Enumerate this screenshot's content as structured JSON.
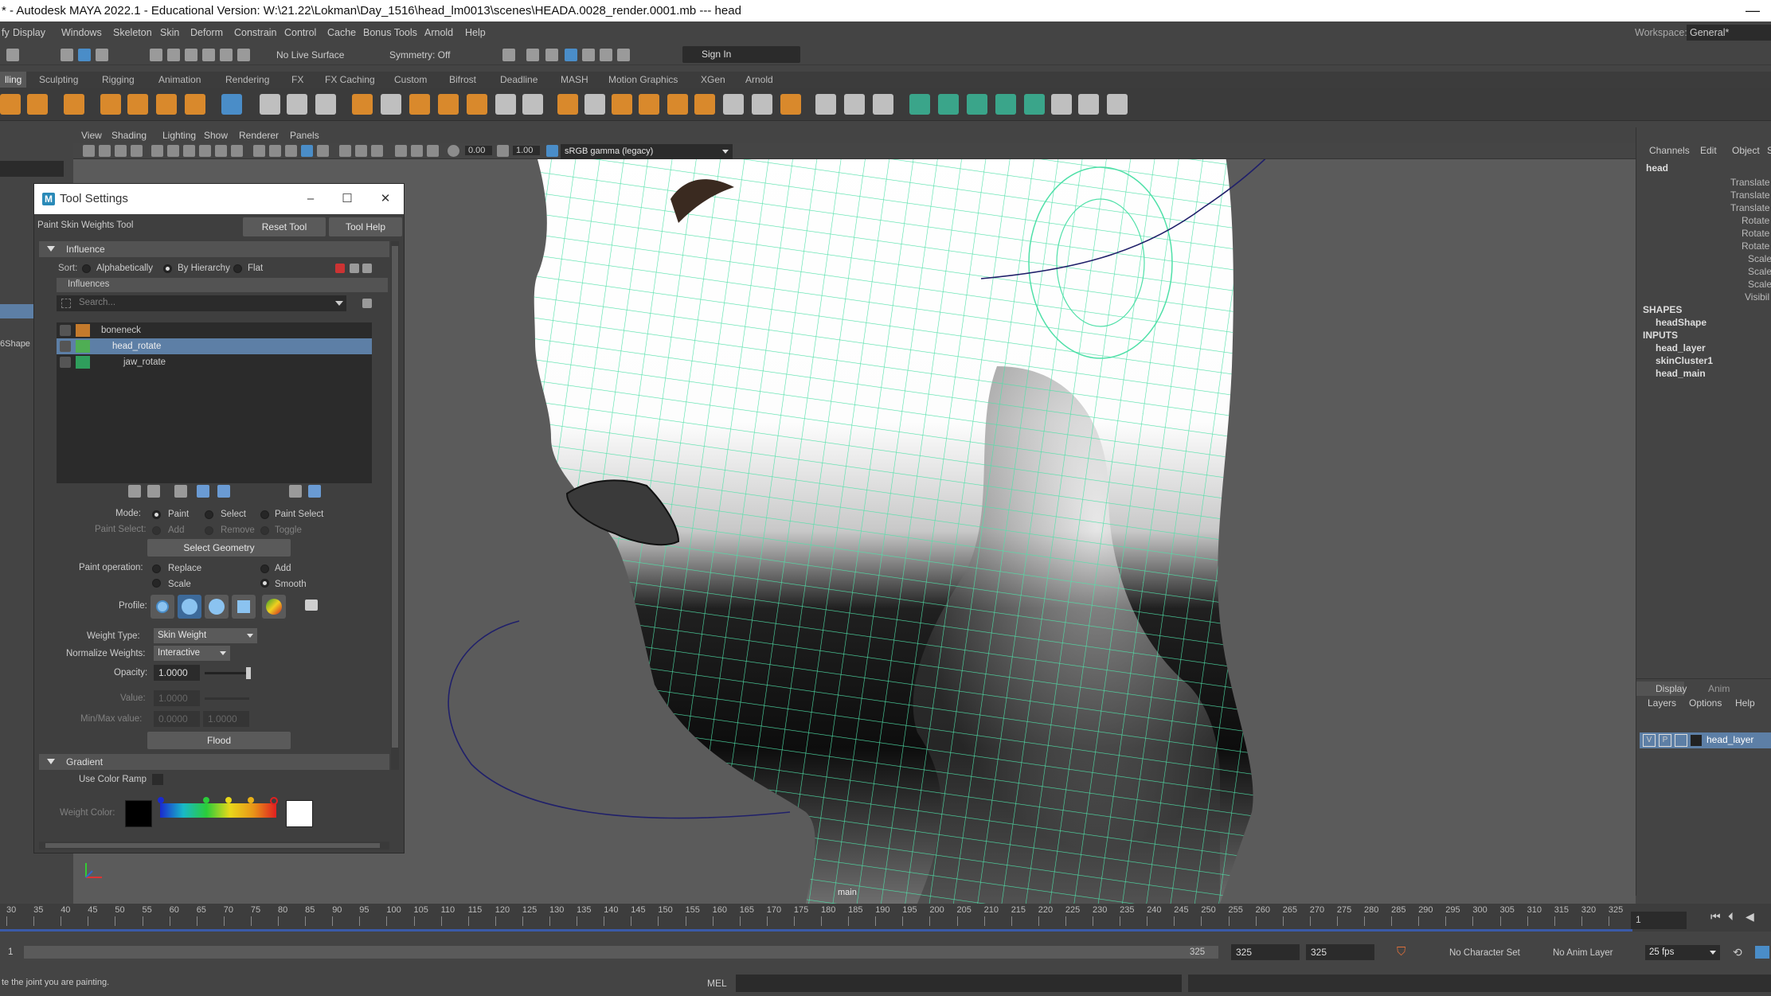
{
  "title": "* - Autodesk MAYA 2022.1 - Educational Version: W:\\21.22\\Lokman\\Day_1516\\head_lm0013\\scenes\\HEADA.0028_render.0001.mb   ---   head",
  "menu": [
    "fy",
    "Display",
    "Windows",
    "Skeleton",
    "Skin",
    "Deform",
    "Constrain",
    "Control",
    "Cache",
    "Bonus Tools",
    "Arnold",
    "Help"
  ],
  "workspace_label": "Workspace:",
  "workspace_value": "General*",
  "status": {
    "live_surface": "No Live Surface",
    "symmetry": "Symmetry: Off",
    "sign_in": "Sign In"
  },
  "shelf_tabs": [
    "lling",
    "Sculpting",
    "Rigging",
    "Animation",
    "Rendering",
    "FX",
    "FX Caching",
    "Custom",
    "Bifrost",
    "Deadline",
    "MASH",
    "Motion Graphics",
    "XGen",
    "Arnold"
  ],
  "viewport_menu": [
    "View",
    "Shading",
    "Lighting",
    "Show",
    "Renderer",
    "Panels"
  ],
  "viewport_tools": {
    "exposure": "0.00",
    "gamma": "1.00",
    "colorspace": "sRGB gamma (legacy)"
  },
  "camera_label": "main",
  "left_item": "6Shape",
  "tool": {
    "window_title": "Tool Settings",
    "tool_name": "Paint Skin Weights Tool",
    "reset": "Reset Tool",
    "help": "Tool Help",
    "influence_section": "Influence",
    "sort_label": "Sort:",
    "sort_options": [
      "Alphabetically",
      "By Hierarchy",
      "Flat"
    ],
    "influences_label": "Influences",
    "search_placeholder": "Search...",
    "influences": [
      {
        "name": "boneneck",
        "color": "#c47a2c",
        "selected": false
      },
      {
        "name": "head_rotate",
        "color": "#4fae54",
        "selected": true
      },
      {
        "name": "jaw_rotate",
        "color": "#2f9e5c",
        "selected": false
      }
    ],
    "mode_label": "Mode:",
    "mode_options": [
      "Paint",
      "Select",
      "Paint Select"
    ],
    "paint_select_label": "Paint Select:",
    "paint_select_options": [
      "Add",
      "Remove",
      "Toggle"
    ],
    "select_geometry": "Select Geometry",
    "paint_op_label": "Paint operation:",
    "paint_ops": [
      "Replace",
      "Add",
      "Scale",
      "Smooth"
    ],
    "profile_label": "Profile:",
    "weight_type_label": "Weight Type:",
    "weight_type": "Skin Weight",
    "normalize_label": "Normalize Weights:",
    "normalize": "Interactive",
    "opacity_label": "Opacity:",
    "opacity": "1.0000",
    "value_label": "Value:",
    "value": "1.0000",
    "minmax_label": "Min/Max value:",
    "min": "0.0000",
    "max": "1.0000",
    "flood": "Flood",
    "gradient_section": "Gradient",
    "use_ramp": "Use Color Ramp",
    "weight_color_label": "Weight Color:"
  },
  "channel": {
    "tabs": [
      "Channels",
      "Edit",
      "Object",
      "S"
    ],
    "object": "head",
    "attrs": [
      "Translate",
      "Translate",
      "Translate",
      "Rotate",
      "Rotate",
      "Rotate",
      "Scale",
      "Scale",
      "Scale",
      "Visibil"
    ],
    "shapes_label": "SHAPES",
    "shape": "headShape",
    "inputs_label": "INPUTS",
    "inputs": [
      "head_layer",
      "skinCluster1",
      "head_main"
    ],
    "layer_tabs": [
      "Display",
      "Anim"
    ],
    "layer_menu": [
      "Layers",
      "Options",
      "Help"
    ],
    "layer_name": "head_layer",
    "layer_flags": [
      "V",
      "P"
    ]
  },
  "timeline": {
    "ticks": [
      30,
      35,
      40,
      45,
      50,
      55,
      60,
      65,
      70,
      75,
      80,
      85,
      90,
      95,
      100,
      105,
      110,
      115,
      120,
      125,
      130,
      135,
      140,
      145,
      150,
      155,
      160,
      165,
      170,
      175,
      180,
      185,
      190,
      195,
      200,
      205,
      210,
      215,
      220,
      225,
      230,
      235,
      240,
      245,
      250,
      255,
      260,
      265,
      270,
      275,
      280,
      285,
      290,
      295,
      300,
      305,
      310,
      315,
      320,
      325
    ],
    "current": "1"
  },
  "range": {
    "start": "1",
    "end_a": "325",
    "end_b": "325",
    "end_c": "325",
    "character_set": "No Character Set",
    "anim_layer": "No Anim Layer",
    "fps": "25 fps"
  },
  "command": {
    "help_line": "te the joint you are painting.",
    "mel": "MEL"
  }
}
